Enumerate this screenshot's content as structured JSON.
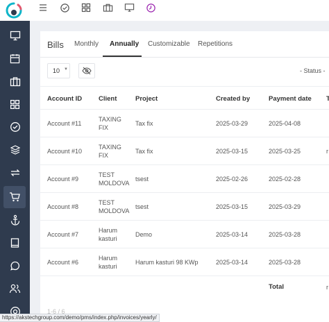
{
  "colors": {
    "sidebar_bg": "#2f3b4e",
    "sidebar_active": "#425067",
    "brand_ring": "#0fb5c9",
    "brand_accent": "#e2566d",
    "history_icon": "#9c27b0"
  },
  "topbar": {
    "icons": [
      "menu-icon",
      "check-circle-icon",
      "grid-icon",
      "briefcase-icon",
      "monitor-icon",
      "history-icon"
    ]
  },
  "sidebar": {
    "items": [
      "monitor-icon",
      "calendar-icon",
      "briefcase-icon",
      "grid-icon",
      "check-circle-icon",
      "layers-icon",
      "repeat-icon",
      "cart-icon",
      "anchor-icon",
      "book-icon",
      "message-icon",
      "users-icon",
      "help-icon"
    ],
    "active": "cart-icon"
  },
  "bills": {
    "title": "Bills",
    "tabs": [
      {
        "label": "Monthly",
        "active": false
      },
      {
        "label": "Annually",
        "active": true
      },
      {
        "label": "Customizable",
        "active": false
      },
      {
        "label": "Repetitions",
        "active": false
      }
    ],
    "page_size": "10",
    "status_filter": "- Status -"
  },
  "table": {
    "headers": [
      "Account ID",
      "Client",
      "Project",
      "Created by",
      "Payment date",
      "T"
    ],
    "rows": [
      {
        "account": "Account #11",
        "client": "TAXING FIX",
        "project": "Tax fix",
        "created": "2025-03-29",
        "payment": "2025-04-08",
        "extra": ""
      },
      {
        "account": "Account #10",
        "client": "TAXING FIX",
        "project": "Tax fix",
        "created": "2025-03-15",
        "payment": "2025-03-25",
        "extra": "r"
      },
      {
        "account": "Account #9",
        "client": "TEST MOLDOVA",
        "project": "tsest",
        "created": "2025-02-26",
        "payment": "2025-02-28",
        "extra": ""
      },
      {
        "account": "Account #8",
        "client": "TEST MOLDOVA",
        "project": "tsest",
        "created": "2025-03-15",
        "payment": "2025-03-29",
        "extra": ""
      },
      {
        "account": "Account #7",
        "client": "Harum kasturi",
        "project": "Demo",
        "created": "2025-03-14",
        "payment": "2025-03-28",
        "extra": ""
      },
      {
        "account": "Account #6",
        "client": "Harum kasturi",
        "project": "Harum kasturi 98 KWp",
        "created": "2025-03-14",
        "payment": "2025-03-28",
        "extra": ""
      }
    ],
    "total_label": "Total",
    "total_extra": "r",
    "pager_text": "1-6 / 6"
  },
  "statusbar": {
    "url": "https://akstechgroup.com/demo/pms/index.php/invoices/yearly/"
  }
}
